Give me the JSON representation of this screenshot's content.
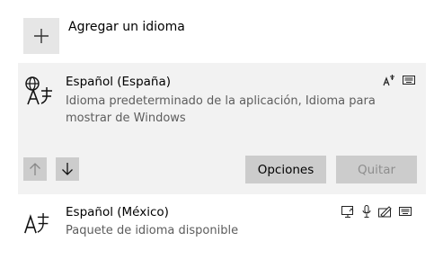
{
  "add_language": {
    "label": "Agregar un idioma",
    "icon": "plus-icon"
  },
  "languages": [
    {
      "name": "Español (España)",
      "description": "Idioma predeterminado de la aplicación, Idioma para mostrar de Windows",
      "icon": "language-globe-icon",
      "features": [
        "text-to-speech-icon",
        "keyboard-icon"
      ]
    },
    {
      "name": "Español (México)",
      "description": "Paquete de idioma disponible",
      "icon": "language-icon",
      "features": [
        "display-language-icon",
        "microphone-icon",
        "handwriting-icon",
        "keyboard-icon"
      ]
    }
  ],
  "actions": {
    "move_up_icon": "arrow-up-icon",
    "move_down_icon": "arrow-down-icon",
    "options_label": "Opciones",
    "remove_label": "Quitar"
  },
  "colors": {
    "selected_bg": "#f2f2f2",
    "button_bg": "#cccccc",
    "secondary_text": "#5d5d5d"
  }
}
